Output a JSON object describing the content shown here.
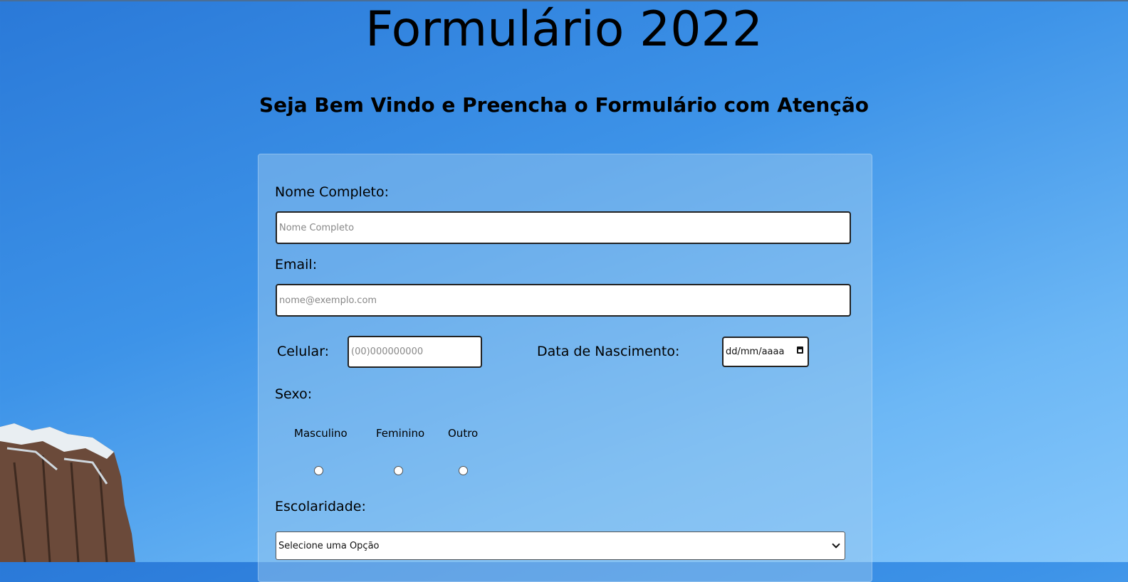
{
  "header": {
    "title": "Formulário 2022",
    "subtitle": "Seja Bem Vindo e Preencha o Formulário com Atenção"
  },
  "form": {
    "nome": {
      "label": "Nome Completo:",
      "placeholder": "Nome Completo"
    },
    "email": {
      "label": "Email:",
      "placeholder": "nome@exemplo.com"
    },
    "celular": {
      "label": "Celular:",
      "placeholder": "(00)000000000"
    },
    "nascimento": {
      "label": "Data de Nascimento:",
      "placeholder": "dd/mm/aaaa"
    },
    "sexo": {
      "label": "Sexo:",
      "options": [
        "Masculino",
        "Feminino",
        "Outro"
      ]
    },
    "escolaridade": {
      "label": "Escolaridade:",
      "selected": "Selecione uma Opção"
    }
  },
  "icons": {
    "date": "calendar-icon",
    "select": "chevron-down-icon"
  }
}
